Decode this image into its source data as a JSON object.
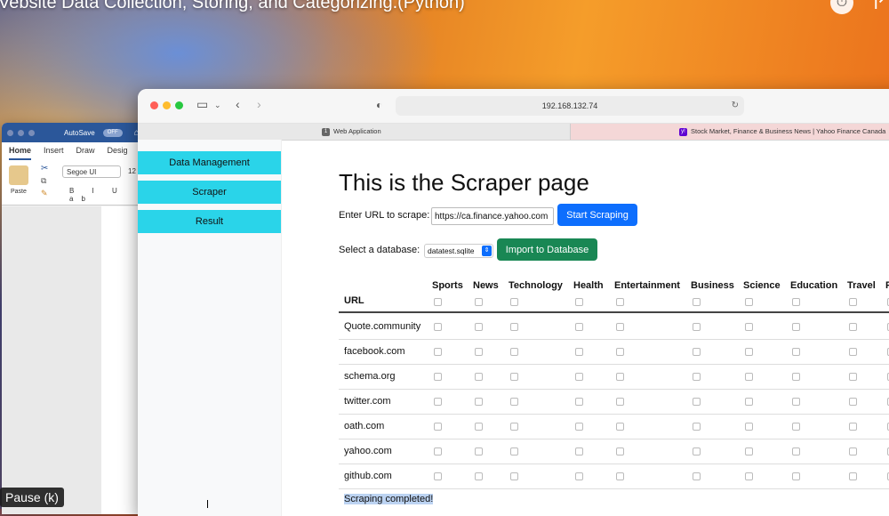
{
  "video": {
    "title": "Vebsite Data Collection, Storing, and Categorizing.(Python)",
    "pause_tooltip": "Pause (k)"
  },
  "word": {
    "autosave_label": "AutoSave",
    "autosave_state": "OFF",
    "tabs": [
      "Home",
      "Insert",
      "Draw",
      "Desig"
    ],
    "paste_label": "Paste",
    "font_name": "Segoe UI",
    "font_size": "12",
    "format_buttons": "B I U ab"
  },
  "browser": {
    "address": "192.168.132.74",
    "tabs": [
      {
        "badge": "1",
        "label": "Web Application"
      },
      {
        "badge": "y!",
        "label": "Stock Market, Finance & Business News | Yahoo Finance Canada"
      }
    ]
  },
  "sidebar": {
    "items": [
      {
        "label": "Data Management"
      },
      {
        "label": "Scraper"
      },
      {
        "label": "Result"
      }
    ]
  },
  "main": {
    "title": "This is the Scraper page",
    "url_label": "Enter URL to scrape:",
    "url_value": "https://ca.finance.yahoo.com",
    "start_button": "Start Scraping",
    "db_label": "Select a database:",
    "db_value": "datatest.sqlite",
    "import_button": "Import to Database",
    "status": "Scraping completed!"
  },
  "table": {
    "url_header": "URL",
    "categories": [
      "Sports",
      "News",
      "Technology",
      "Health",
      "Entertainment",
      "Business",
      "Science",
      "Education",
      "Travel",
      "F"
    ],
    "rows": [
      "Quote.community",
      "facebook.com",
      "schema.org",
      "twitter.com",
      "oath.com",
      "yahoo.com",
      "github.com"
    ]
  },
  "colors": {
    "sidebar_button": "#2ad4e9",
    "primary_button": "#0d6efd",
    "success_button": "#198754"
  }
}
